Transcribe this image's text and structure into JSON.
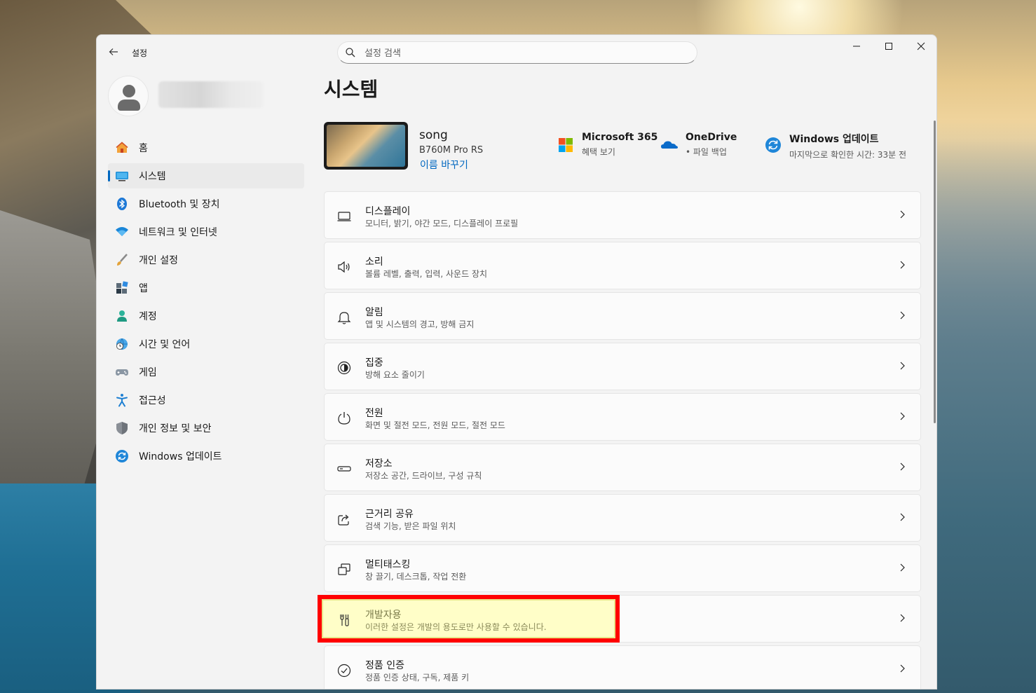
{
  "window": {
    "app_title": "설정",
    "search_placeholder": "설정 검색",
    "minimize": "—",
    "maximize": "☐",
    "close": "✕"
  },
  "sidebar": {
    "items": [
      {
        "label": "홈",
        "icon": "home-icon"
      },
      {
        "label": "시스템",
        "icon": "system-icon",
        "selected": true
      },
      {
        "label": "Bluetooth 및 장치",
        "icon": "bluetooth-icon"
      },
      {
        "label": "네트워크 및 인터넷",
        "icon": "wifi-icon"
      },
      {
        "label": "개인 설정",
        "icon": "brush-icon"
      },
      {
        "label": "앱",
        "icon": "apps-icon"
      },
      {
        "label": "계정",
        "icon": "account-icon"
      },
      {
        "label": "시간 및 언어",
        "icon": "globe-clock-icon"
      },
      {
        "label": "게임",
        "icon": "gamepad-icon"
      },
      {
        "label": "접근성",
        "icon": "accessibility-icon"
      },
      {
        "label": "개인 정보 및 보안",
        "icon": "shield-icon"
      },
      {
        "label": "Windows 업데이트",
        "icon": "update-icon"
      }
    ]
  },
  "main": {
    "title": "시스템",
    "device": {
      "name": "song",
      "model": "B760M Pro RS",
      "rename_link": "이름 바꾸기"
    },
    "quick": [
      {
        "title": "Microsoft 365",
        "sub": "혜택 보기",
        "icon": "microsoft-365-icon"
      },
      {
        "title": "OneDrive",
        "sub": "• 파일 백업",
        "icon": "onedrive-icon"
      },
      {
        "title": "Windows 업데이트",
        "sub": "마지막으로 확인한 시간: 33분 전",
        "icon": "windows-update-icon"
      }
    ],
    "cards": [
      {
        "title": "디스플레이",
        "sub": "모니터, 밝기, 야간 모드, 디스플레이 프로필",
        "icon": "display-icon"
      },
      {
        "title": "소리",
        "sub": "볼륨 레벨, 출력, 입력, 사운드 장치",
        "icon": "speaker-icon"
      },
      {
        "title": "알림",
        "sub": "앱 및 시스템의 경고, 방해 금지",
        "icon": "bell-icon"
      },
      {
        "title": "집중",
        "sub": "방해 요소 줄이기",
        "icon": "focus-icon"
      },
      {
        "title": "전원",
        "sub": "화면 및 절전 모드, 전원 모드, 절전 모드",
        "icon": "power-icon"
      },
      {
        "title": "저장소",
        "sub": "저장소 공간, 드라이브, 구성 규칙",
        "icon": "storage-icon"
      },
      {
        "title": "근거리 공유",
        "sub": "검색 기능, 받은 파일 위치",
        "icon": "share-icon"
      },
      {
        "title": "멀티태스킹",
        "sub": "창 끌기, 데스크톱, 작업 전환",
        "icon": "multitask-icon"
      },
      {
        "title": "개발자용",
        "sub": "이러한 설정은 개발의 용도로만 사용할 수 있습니다.",
        "icon": "developer-icon",
        "highlighted": true
      },
      {
        "title": "정품 인증",
        "sub": "정품 인증 상태, 구독, 제품 키",
        "icon": "activation-icon"
      }
    ]
  },
  "colors": {
    "accent": "#0067c0",
    "highlight_border": "#ff0000",
    "highlight_fill": "#fffec8"
  }
}
